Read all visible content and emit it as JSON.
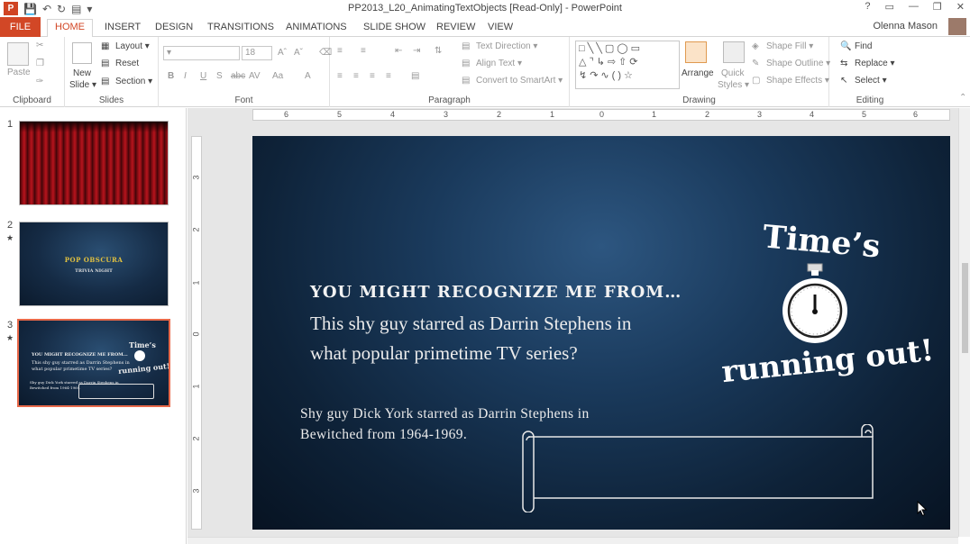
{
  "window": {
    "title": "PP2013_L20_AnimatingTextObjects [Read-Only] - PowerPoint",
    "controls": [
      "?",
      "▭",
      "—",
      "❐",
      "✕"
    ]
  },
  "tabs": [
    "FILE",
    "HOME",
    "INSERT",
    "DESIGN",
    "TRANSITIONS",
    "ANIMATIONS",
    "SLIDE SHOW",
    "REVIEW",
    "VIEW"
  ],
  "active_tab": "HOME",
  "user": {
    "name": "Olenna Mason"
  },
  "ribbon": {
    "clipboard": {
      "label": "Clipboard",
      "paste": "Paste"
    },
    "slides": {
      "label": "Slides",
      "new_slide_1": "New",
      "new_slide_2": "Slide ▾",
      "layout": "Layout ▾",
      "reset": "Reset",
      "section": "Section ▾"
    },
    "font": {
      "label": "Font",
      "size": "18"
    },
    "paragraph": {
      "label": "Paragraph",
      "text_direction": "Text Direction ▾",
      "align_text": "Align Text ▾",
      "convert_smartart": "Convert to SmartArt ▾"
    },
    "drawing": {
      "label": "Drawing",
      "arrange": "Arrange",
      "quick_styles_1": "Quick",
      "quick_styles_2": "Styles ▾",
      "shape_fill": "Shape Fill ▾",
      "shape_outline": "Shape Outline ▾",
      "shape_effects": "Shape Effects ▾"
    },
    "editing": {
      "label": "Editing",
      "find": "Find",
      "replace": "Replace ▾",
      "select": "Select ▾"
    }
  },
  "thumbnails": [
    {
      "num": "1",
      "star": ""
    },
    {
      "num": "2",
      "star": "★",
      "title": "POP OBSCURA",
      "subtitle": "TRIVIA NIGHT"
    },
    {
      "num": "3",
      "star": "★"
    }
  ],
  "slide": {
    "heading": "YOU MIGHT RECOGNIZE ME FROM…",
    "question_line1": "This shy guy starred as Darrin Stephens in",
    "question_line2": "what popular primetime TV series?",
    "answer_line1": "Shy guy Dick York starred as Darrin Stephens in",
    "answer_line2": "Bewitched from 1964-1969.",
    "times_text": "Time’s",
    "running_text": "running out!"
  },
  "ruler": {
    "h": [
      "6",
      "5",
      "4",
      "3",
      "2",
      "1",
      "0",
      "1",
      "2",
      "3",
      "4",
      "5",
      "6"
    ],
    "v": [
      "3",
      "2",
      "1",
      "0",
      "1",
      "2",
      "3"
    ]
  },
  "colors": {
    "accent": "#d24726",
    "slide_bg": "#0e2238",
    "thumb_selected_border": "#e8694a"
  }
}
